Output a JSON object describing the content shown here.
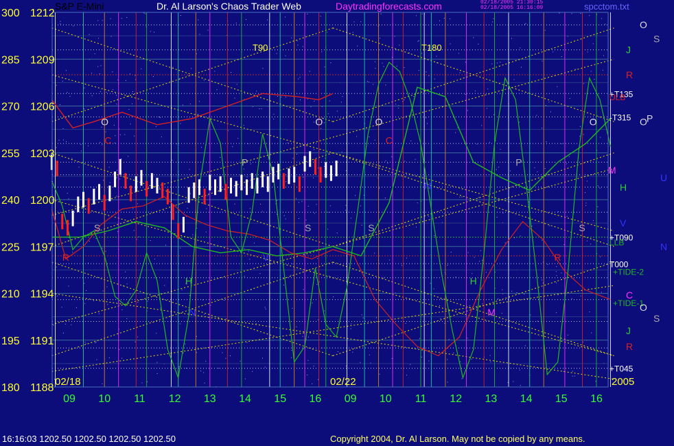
{
  "header": {
    "title_left": "S&P E-Mini",
    "title_main": "Dr. Al Larson's Chaos Trader Web",
    "site": "Daytradingforecasts.com",
    "file_lines": [
      "02/18/2005 21:30:15",
      "02/18/2005 16:16:09"
    ],
    "file_name": "spcctom.txt"
  },
  "footer": {
    "quote": "16:16:03  1202.50  1202.50  1202.50  1202.50",
    "copyright": "Copyright 2004, Dr. Al Larson. May not be copied by any means."
  },
  "colors": {
    "background": "#0c0c7a",
    "price_bars": "#ffffff",
    "down_bars": "#ff2020",
    "tide": "#22b822",
    "ulb_llb": "#d42222",
    "diagonal": "#e8e000",
    "axis_labels": "#ffff33",
    "hour_labels": "#33ff33",
    "site": "#ff33ff"
  },
  "chart_data": {
    "type": "line",
    "title": "S&P E-Mini",
    "ylabels_left": [
      {
        "deg": "300",
        "price": "1212"
      },
      {
        "deg": "285",
        "price": "1209"
      },
      {
        "deg": "270",
        "price": "1206"
      },
      {
        "deg": "255",
        "price": "1203"
      },
      {
        "deg": "240",
        "price": "1200"
      },
      {
        "deg": "225",
        "price": "1197"
      },
      {
        "deg": "210",
        "price": "1194"
      },
      {
        "deg": "195",
        "price": "1191"
      },
      {
        "deg": "180",
        "price": "1188"
      }
    ],
    "ylim": [
      1188,
      1212
    ],
    "x_hours": [
      "09",
      "10",
      "11",
      "12",
      "13",
      "14",
      "15",
      "16",
      "09",
      "10",
      "11",
      "12",
      "13",
      "14",
      "15",
      "16"
    ],
    "date_labels": [
      "02/18",
      "02/22",
      "2005"
    ],
    "top_labels": [
      "T90",
      "T180"
    ],
    "right_labels": [
      {
        "text": "O",
        "color": "#dddddd",
        "y": 1211.2
      },
      {
        "text": "S",
        "color": "#aaaaaa",
        "y": 1210.3
      },
      {
        "text": "J",
        "color": "#33cc33",
        "y": 1209.6
      },
      {
        "text": "R",
        "color": "#dd2222",
        "y": 1208.0
      },
      {
        "text": "+T135",
        "color": "#ffffff",
        "y": 1206.8
      },
      {
        "text": "ULB",
        "color": "#dd2222",
        "y": 1206.6
      },
      {
        "text": "-T315",
        "color": "#ffffff",
        "y": 1205.3
      },
      {
        "text": "O",
        "color": "#dddddd",
        "y": 1205.0
      },
      {
        "text": "P",
        "color": "#dddddd",
        "y": 1205.2
      },
      {
        "text": "M",
        "color": "#ff33ff",
        "y": 1201.9
      },
      {
        "text": "U",
        "color": "#3333ff",
        "y": 1201.4
      },
      {
        "text": "H",
        "color": "#33cc33",
        "y": 1200.8
      },
      {
        "text": "V",
        "color": "#3333ff",
        "y": 1198.5
      },
      {
        "text": "+T090",
        "color": "#ffffff",
        "y": 1197.6
      },
      {
        "text": "LLB",
        "color": "#22b822",
        "y": 1197.3
      },
      {
        "text": "N",
        "color": "#3333ff",
        "y": 1197.0
      },
      {
        "text": "T000",
        "color": "#ffffff",
        "y": 1195.9
      },
      {
        "text": "+TIDE-2",
        "color": "#22b822",
        "y": 1195.4
      },
      {
        "text": "C",
        "color": "#ff33ff",
        "y": 1193.9
      },
      {
        "text": "+TIDE-1",
        "color": "#22b822",
        "y": 1193.4
      },
      {
        "text": "O",
        "color": "#dddddd",
        "y": 1193.1
      },
      {
        "text": "S",
        "color": "#aaaaaa",
        "y": 1192.4
      },
      {
        "text": "J",
        "color": "#33cc33",
        "y": 1191.6
      },
      {
        "text": "R",
        "color": "#dd2222",
        "y": 1190.6
      },
      {
        "text": "+T045",
        "color": "#ffffff",
        "y": 1189.2
      }
    ],
    "in_chart_letters": [
      {
        "t": "O",
        "c": "#dddddd",
        "x": 1.4,
        "y": 1205.0
      },
      {
        "t": "C",
        "c": "#dd2222",
        "x": 1.5,
        "y": 1203.8
      },
      {
        "t": "S",
        "c": "#aaaaaa",
        "x": 1.2,
        "y": 1198.2
      },
      {
        "t": "R",
        "c": "#dd2222",
        "x": 0.3,
        "y": 1196.3
      },
      {
        "t": "H",
        "c": "#33cc33",
        "x": 3.8,
        "y": 1194.8
      },
      {
        "t": "N",
        "c": "#3333ff",
        "x": 3.9,
        "y": 1192.8
      },
      {
        "t": "P",
        "c": "#aaaaaa",
        "x": 5.4,
        "y": 1202.4
      },
      {
        "t": "V",
        "c": "#3333ff",
        "x": 6.0,
        "y": 1196.3
      },
      {
        "t": "S",
        "c": "#aaaaaa",
        "x": 7.2,
        "y": 1198.2
      },
      {
        "t": "O",
        "c": "#dddddd",
        "x": 7.5,
        "y": 1205.0
      },
      {
        "t": "O",
        "c": "#dddddd",
        "x": 9.2,
        "y": 1205.0
      },
      {
        "t": "C",
        "c": "#dd2222",
        "x": 9.5,
        "y": 1203.8
      },
      {
        "t": "S",
        "c": "#aaaaaa",
        "x": 9.0,
        "y": 1198.2
      },
      {
        "t": "N",
        "c": "#3333ff",
        "x": 10.6,
        "y": 1200.9
      },
      {
        "t": "H",
        "c": "#33cc33",
        "x": 11.9,
        "y": 1194.8
      },
      {
        "t": "M",
        "c": "#ff33ff",
        "x": 12.4,
        "y": 1192.8
      },
      {
        "t": "P",
        "c": "#aaaaaa",
        "x": 13.2,
        "y": 1202.4
      },
      {
        "t": "R",
        "c": "#dd2222",
        "x": 14.3,
        "y": 1196.3
      },
      {
        "t": "S",
        "c": "#aaaaaa",
        "x": 15.0,
        "y": 1198.2
      },
      {
        "t": "O",
        "c": "#dddddd",
        "x": 15.3,
        "y": 1205.0
      }
    ],
    "price": {
      "x": [
        0.0,
        0.15,
        0.3,
        0.45,
        0.6,
        0.75,
        0.9,
        1.05,
        1.2,
        1.35,
        1.5,
        1.65,
        1.8,
        1.95,
        2.1,
        2.25,
        2.4,
        2.55,
        2.7,
        2.85,
        3.0,
        3.15,
        3.3,
        3.45,
        3.6,
        3.75,
        3.9,
        4.05,
        4.2,
        4.35,
        4.5,
        4.65,
        4.8,
        4.95,
        5.1,
        5.25,
        5.4,
        5.55,
        5.7,
        5.85,
        6.0,
        6.15,
        6.3,
        6.45,
        6.6,
        6.75,
        6.9,
        7.05,
        7.2,
        7.35,
        7.5,
        7.65,
        7.8,
        7.95,
        8.1
      ],
      "y": [
        1202.4,
        1202.0,
        1198.6,
        1198.2,
        1198.8,
        1199.7,
        1200.0,
        1199.6,
        1200.2,
        1200.5,
        1199.8,
        1200.4,
        1201.3,
        1202.1,
        1201.2,
        1200.4,
        1201.0,
        1201.4,
        1200.7,
        1201.2,
        1200.9,
        1200.6,
        1200.2,
        1199.2,
        1198.0,
        1198.4,
        1200.3,
        1200.6,
        1200.8,
        1200.2,
        1201.1,
        1200.8,
        1201.0,
        1200.5,
        1200.9,
        1200.7,
        1201.1,
        1200.8,
        1201.2,
        1200.9,
        1201.3,
        1201.0,
        1201.6,
        1201.8,
        1201.2,
        1201.5,
        1201.6,
        1201.0,
        1202.3,
        1202.6,
        1202.1,
        1201.6,
        1201.9,
        1201.7,
        1202.0
      ]
    },
    "tide": {
      "x": [
        0.0,
        0.3,
        0.6,
        0.9,
        1.2,
        1.5,
        1.8,
        2.1,
        2.4,
        2.7,
        3.0,
        3.3,
        3.6,
        3.9,
        4.2,
        4.5,
        4.8,
        5.1,
        5.4,
        5.7,
        6.0,
        6.3,
        6.6,
        6.9,
        7.2,
        7.5,
        7.8,
        8.1,
        8.4,
        8.7,
        9.0,
        9.3,
        9.6,
        9.9,
        10.2,
        10.5,
        10.8,
        11.1,
        11.4,
        11.7,
        12.0,
        12.3,
        12.6,
        12.9,
        13.2,
        13.5,
        13.8,
        14.1,
        14.4,
        14.7,
        15.0,
        15.3,
        15.6,
        15.9
      ],
      "y": [
        1201.2,
        1199.6,
        1196.8,
        1197.6,
        1198.0,
        1196.4,
        1193.8,
        1193.2,
        1194.2,
        1196.6,
        1194.8,
        1190.4,
        1188.6,
        1192.6,
        1200.8,
        1205.2,
        1203.6,
        1197.6,
        1196.6,
        1199.2,
        1204.2,
        1201.6,
        1195.6,
        1189.6,
        1190.6,
        1195.6,
        1192.0,
        1191.2,
        1194.4,
        1199.2,
        1204.2,
        1207.4,
        1208.8,
        1208.2,
        1206.4,
        1203.6,
        1199.4,
        1195.2,
        1191.6,
        1188.6,
        1190.4,
        1196.6,
        1203.6,
        1207.8,
        1206.4,
        1201.0,
        1195.2,
        1188.8,
        1189.6,
        1195.6,
        1203.2,
        1207.8,
        1206.4,
        1203.4
      ]
    },
    "smooth_green": {
      "x": [
        0.0,
        0.8,
        1.6,
        2.4,
        3.2,
        4.0,
        4.8,
        5.6,
        6.4,
        7.2,
        8.0,
        8.8,
        9.6,
        10.4,
        11.2,
        12.0,
        12.8,
        13.6,
        14.4,
        15.2,
        15.9
      ],
      "y": [
        1197.6,
        1197.6,
        1198.0,
        1198.6,
        1198.2,
        1197.0,
        1196.6,
        1196.8,
        1196.4,
        1196.6,
        1197.0,
        1196.4,
        1199.8,
        1207.2,
        1206.6,
        1202.4,
        1201.4,
        1200.6,
        1202.4,
        1203.6,
        1205.2
      ]
    },
    "ulb": {
      "x": [
        0.0,
        0.6,
        1.2,
        2.0,
        3.0,
        4.0,
        5.0,
        6.0,
        7.0,
        7.6,
        8.0
      ],
      "y": [
        1206.4,
        1204.6,
        1205.0,
        1205.6,
        1204.8,
        1205.2,
        1206.0,
        1206.8,
        1206.6,
        1206.4,
        1206.8
      ]
    },
    "lower_red": {
      "x": [
        0.0,
        0.4,
        0.9,
        1.4,
        2.0,
        2.6,
        3.2,
        3.8,
        4.4,
        5.0,
        5.6,
        6.2,
        6.8,
        7.4,
        8.0,
        8.6,
        9.2,
        9.8,
        10.4,
        11.0,
        11.6,
        12.2,
        12.8,
        13.4,
        14.0,
        14.6,
        15.2,
        15.9
      ],
      "y": [
        1199.4,
        1196.2,
        1197.0,
        1198.4,
        1199.4,
        1199.6,
        1200.2,
        1199.0,
        1198.4,
        1198.0,
        1197.8,
        1197.4,
        1196.6,
        1196.2,
        1196.8,
        1196.4,
        1193.6,
        1192.0,
        1190.6,
        1190.0,
        1191.2,
        1194.2,
        1196.8,
        1198.6,
        1197.4,
        1195.4,
        1194.2,
        1193.6
      ]
    },
    "grid": true,
    "legend": "right"
  }
}
